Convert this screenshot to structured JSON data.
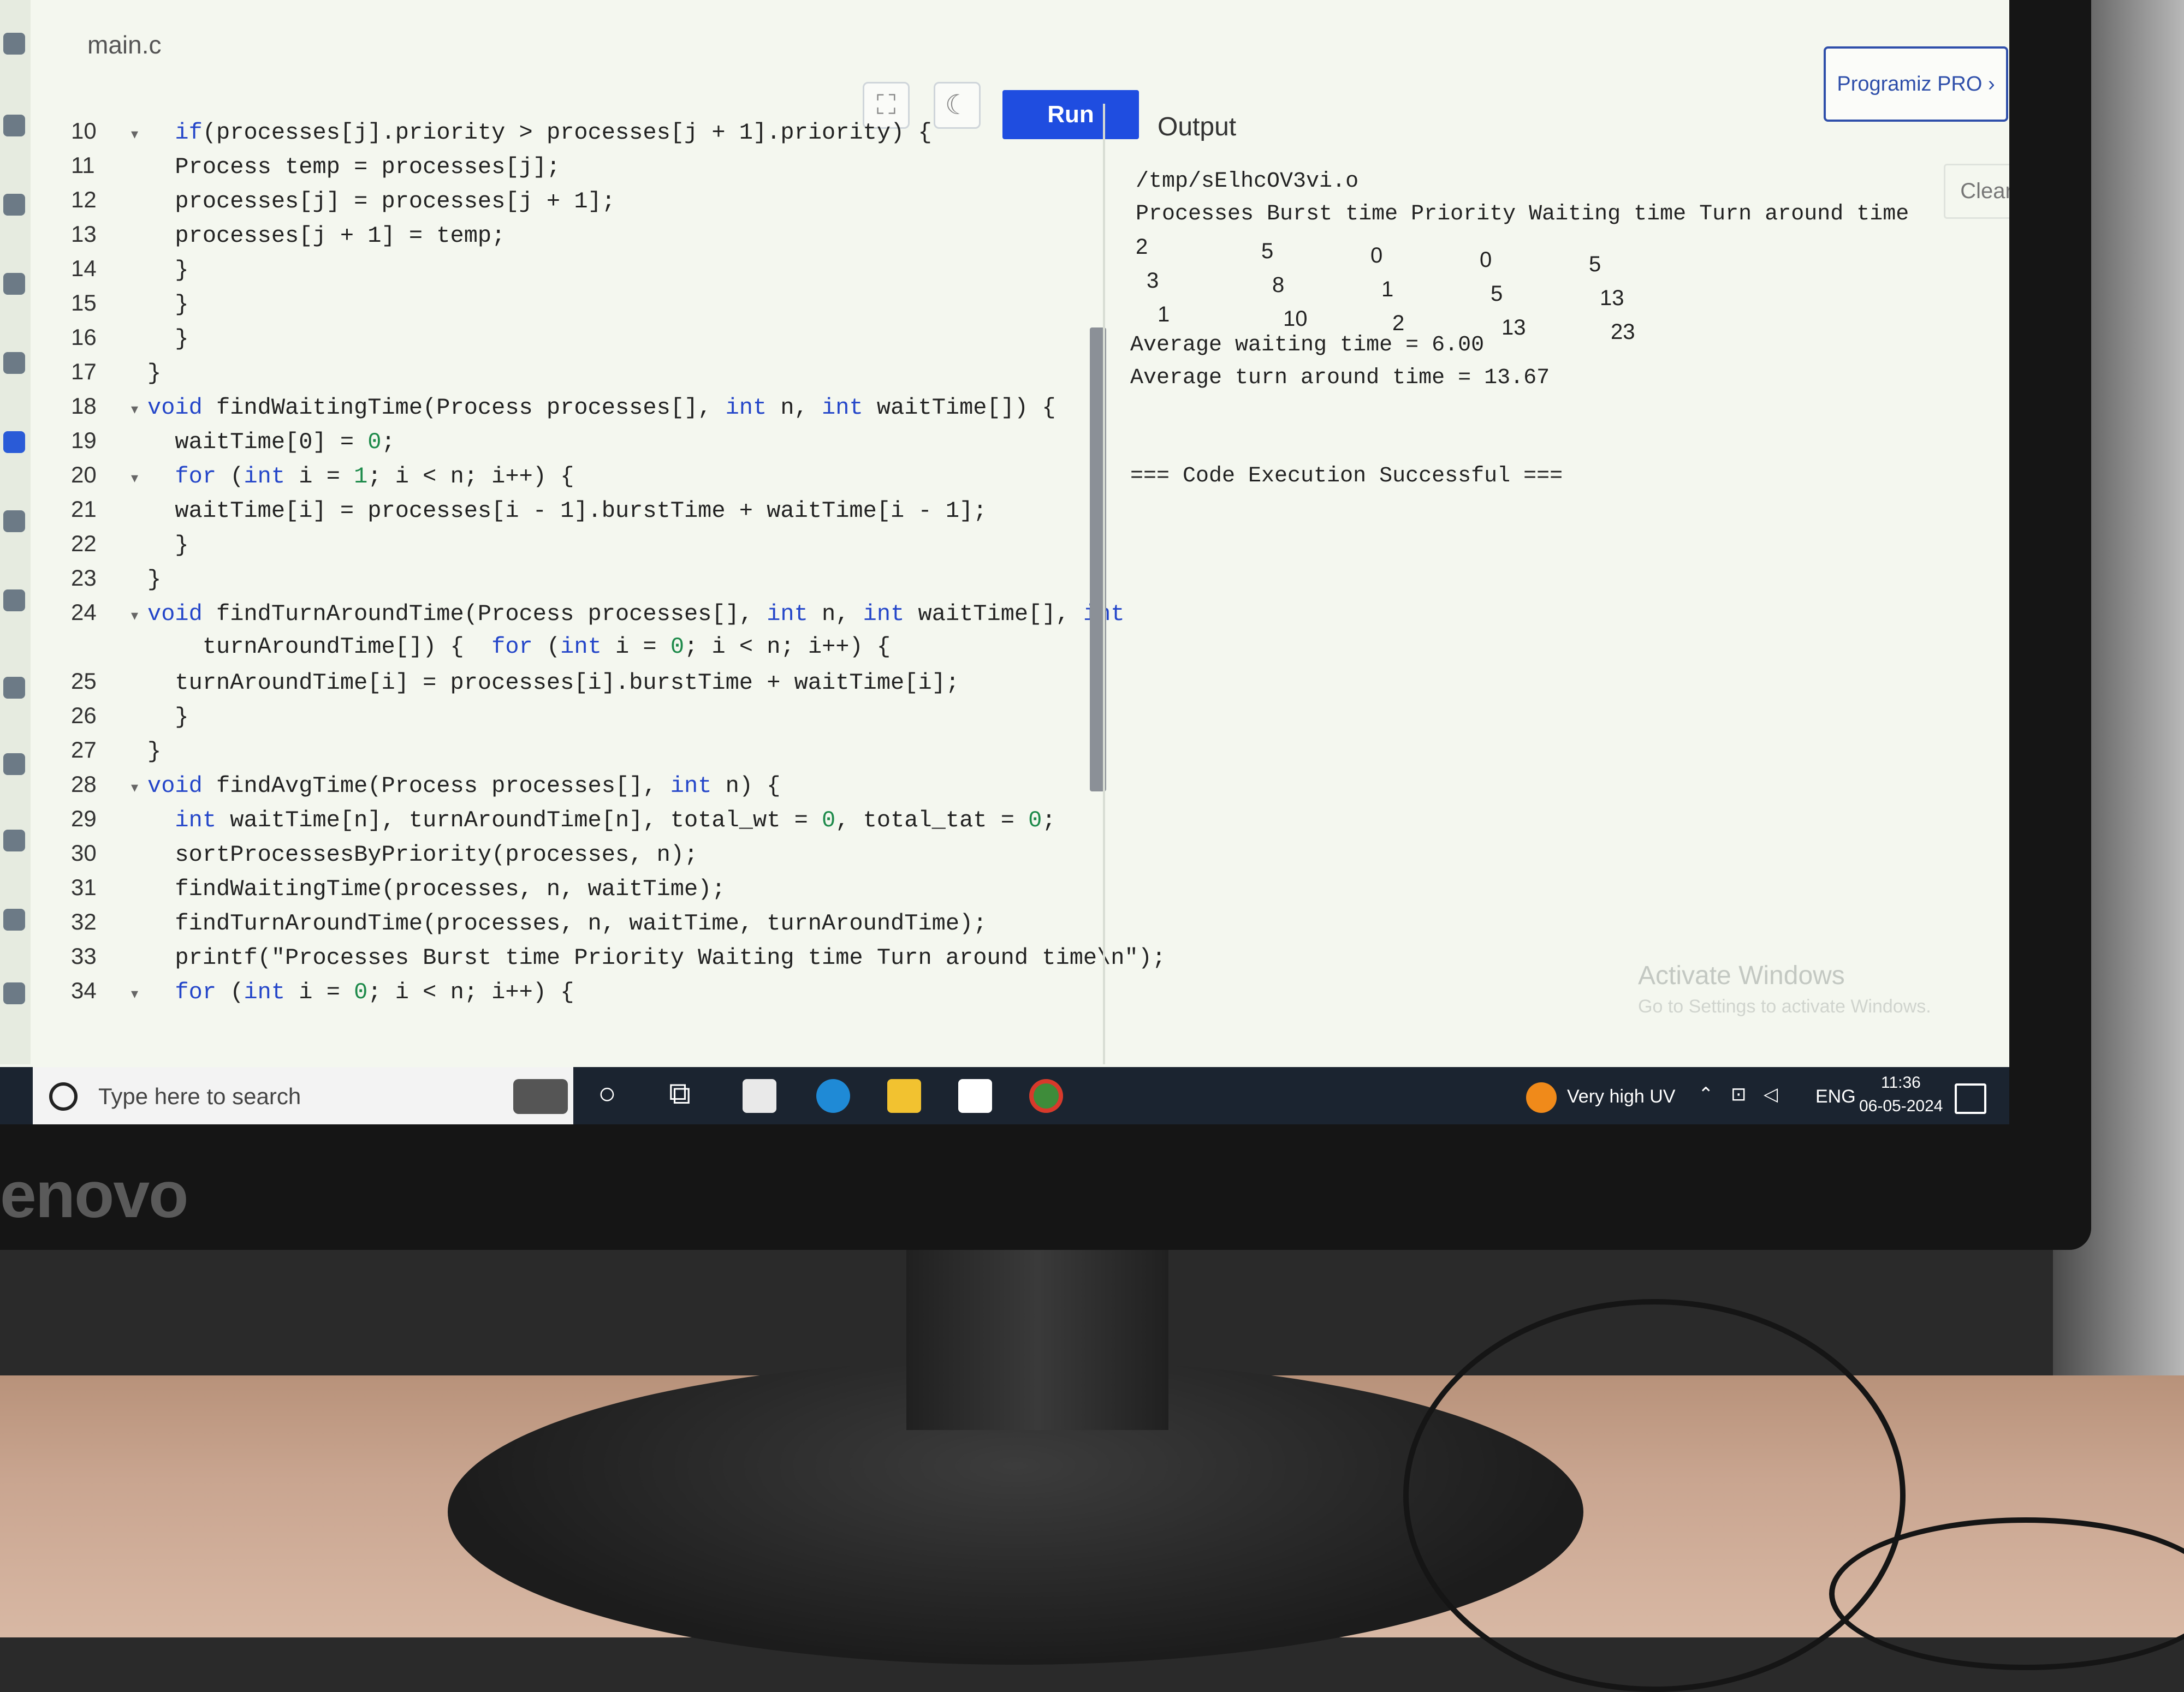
{
  "brand": "enovo",
  "editor": {
    "file_tab": "main.c",
    "run_label": "Run",
    "fullscreen_icon": "fullscreen-icon",
    "theme_icon": "moon-icon",
    "lines": [
      {
        "n": "10",
        "fold": true,
        "tokens": [
          [
            "kw",
            "if"
          ],
          [
            "",
            "(processes[j].priority > processes[j + 1].priority) {"
          ]
        ]
      },
      {
        "n": "11",
        "fold": false,
        "tokens": [
          [
            "",
            "Process temp = processes[j];"
          ]
        ]
      },
      {
        "n": "12",
        "fold": false,
        "tokens": [
          [
            "",
            "processes[j] = processes[j + 1];"
          ]
        ]
      },
      {
        "n": "13",
        "fold": false,
        "tokens": [
          [
            "",
            "processes[j + 1] = temp;"
          ]
        ]
      },
      {
        "n": "14",
        "fold": false,
        "tokens": [
          [
            "",
            "}"
          ]
        ]
      },
      {
        "n": "15",
        "fold": false,
        "tokens": [
          [
            "",
            "}"
          ]
        ]
      },
      {
        "n": "16",
        "fold": false,
        "tokens": [
          [
            "",
            "}"
          ]
        ]
      },
      {
        "n": "17",
        "fold": false,
        "tokens": [
          [
            "",
            "}"
          ]
        ]
      },
      {
        "n": "18",
        "fold": true,
        "tokens": [
          [
            "kw",
            "void"
          ],
          [
            "",
            " findWaitingTime(Process processes[], "
          ],
          [
            "kw",
            "int"
          ],
          [
            "",
            " n, "
          ],
          [
            "kw",
            "int"
          ],
          [
            "",
            " waitTime[]) {"
          ]
        ]
      },
      {
        "n": "19",
        "fold": false,
        "tokens": [
          [
            "",
            "waitTime[0] = "
          ],
          [
            "num",
            "0"
          ],
          [
            "",
            ";"
          ]
        ]
      },
      {
        "n": "20",
        "fold": true,
        "tokens": [
          [
            "kw",
            "for"
          ],
          [
            "",
            " ("
          ],
          [
            "kw",
            "int"
          ],
          [
            "",
            " i = "
          ],
          [
            "num",
            "1"
          ],
          [
            "",
            "; i < n; i++) {"
          ]
        ]
      },
      {
        "n": "21",
        "fold": false,
        "tokens": [
          [
            "",
            "waitTime[i] = processes[i - 1].burstTime + waitTime[i - 1];"
          ]
        ]
      },
      {
        "n": "22",
        "fold": false,
        "tokens": [
          [
            "",
            "}"
          ]
        ]
      },
      {
        "n": "23",
        "fold": false,
        "tokens": [
          [
            "",
            "}"
          ]
        ]
      },
      {
        "n": "24",
        "fold": true,
        "tokens": [
          [
            "kw",
            "void"
          ],
          [
            "",
            " findTurnAroundTime(Process processes[], "
          ],
          [
            "kw",
            "int"
          ],
          [
            "",
            " n, "
          ],
          [
            "kw",
            "int"
          ],
          [
            "",
            " waitTime[], "
          ],
          [
            "kw",
            "int"
          ]
        ]
      },
      {
        "n": "",
        "fold": false,
        "tokens": [
          [
            "",
            "    turnAroundTime[]) {  "
          ],
          [
            "kw",
            "for"
          ],
          [
            "",
            " ("
          ],
          [
            "kw",
            "int"
          ],
          [
            "",
            " i = "
          ],
          [
            "num",
            "0"
          ],
          [
            "",
            "; i < n; i++) {"
          ]
        ]
      },
      {
        "n": "25",
        "fold": false,
        "tokens": [
          [
            "",
            "turnAroundTime[i] = processes[i].burstTime + waitTime[i];"
          ]
        ]
      },
      {
        "n": "26",
        "fold": false,
        "tokens": [
          [
            "",
            "}"
          ]
        ]
      },
      {
        "n": "27",
        "fold": false,
        "tokens": [
          [
            "",
            "}"
          ]
        ]
      },
      {
        "n": "28",
        "fold": true,
        "tokens": [
          [
            "kw",
            "void"
          ],
          [
            "",
            " findAvgTime(Process processes[], "
          ],
          [
            "kw",
            "int"
          ],
          [
            "",
            " n) {"
          ]
        ]
      },
      {
        "n": "29",
        "fold": false,
        "tokens": [
          [
            "kw",
            "int"
          ],
          [
            "",
            " waitTime[n], turnAroundTime[n], total_wt = "
          ],
          [
            "num",
            "0"
          ],
          [
            "",
            ", total_tat = "
          ],
          [
            "num",
            "0"
          ],
          [
            "",
            ";"
          ]
        ]
      },
      {
        "n": "30",
        "fold": false,
        "tokens": [
          [
            "",
            "sortProcessesByPriority(processes, n);"
          ]
        ]
      },
      {
        "n": "31",
        "fold": false,
        "tokens": [
          [
            "",
            "findWaitingTime(processes, n, waitTime);"
          ]
        ]
      },
      {
        "n": "32",
        "fold": false,
        "tokens": [
          [
            "",
            "findTurnAroundTime(processes, n, waitTime, turnAroundTime);"
          ]
        ]
      },
      {
        "n": "33",
        "fold": false,
        "tokens": [
          [
            "",
            "printf(\"Processes Burst time Priority Waiting time Turn around time\\n\");"
          ]
        ]
      },
      {
        "n": "34",
        "fold": true,
        "tokens": [
          [
            "kw",
            "for"
          ],
          [
            "",
            " ("
          ],
          [
            "kw",
            "int"
          ],
          [
            "",
            " i = "
          ],
          [
            "num",
            "0"
          ],
          [
            "",
            "; i < n; i++) {"
          ]
        ]
      }
    ]
  },
  "output": {
    "title": "Output",
    "pro_label": "Programiz PRO ›",
    "clear_label": "Clear",
    "path": "/tmp/sElhcOV3vi.o",
    "header": "Processes Burst time Priority Waiting time Turn around time",
    "rows": [
      [
        "2",
        "5",
        "0",
        "0",
        "5"
      ],
      [
        "3",
        "8",
        "1",
        "5",
        "13"
      ],
      [
        "1",
        "10",
        "2",
        "13",
        "23"
      ]
    ],
    "avg_wait": "Average waiting time = 6.00",
    "avg_tat": "Average turn around time = 13.67",
    "status": "=== Code Execution Successful ==="
  },
  "watermark": {
    "line1": "Activate Windows",
    "line2": "Go to Settings to activate Windows."
  },
  "taskbar": {
    "search_placeholder": "Type here to search",
    "weather": "Very high UV",
    "lang": "ENG",
    "time": "11:36",
    "date": "06-05-2024",
    "icons": [
      "cortana-icon",
      "task-view-icon",
      "mail-icon",
      "edge-icon",
      "file-explorer-icon",
      "store-icon",
      "chrome-icon"
    ]
  }
}
